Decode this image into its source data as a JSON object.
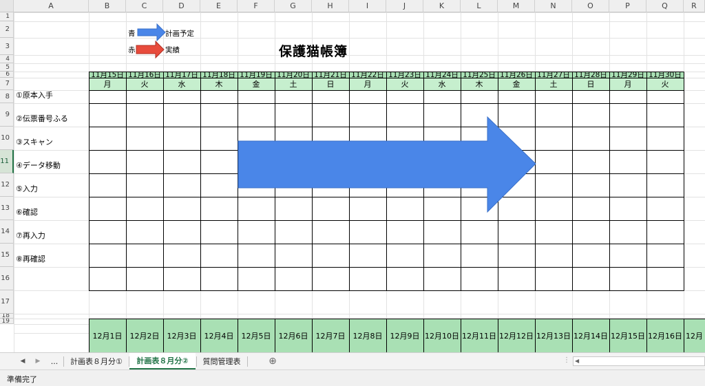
{
  "columns": [
    "A",
    "B",
    "C",
    "D",
    "E",
    "F",
    "G",
    "H",
    "I",
    "J",
    "K",
    "L",
    "M",
    "N",
    "O",
    "P",
    "Q",
    "R"
  ],
  "rows": [
    "1",
    "2",
    "3",
    "4",
    "5",
    "6",
    "7",
    "8",
    "9",
    "10",
    "11",
    "12",
    "13",
    "14",
    "15",
    "16",
    "17",
    "18",
    "19"
  ],
  "legend": {
    "blue_label": "青",
    "blue_text": "計画予定",
    "red_label": "赤",
    "red_text": "実績",
    "blue_color": "#4a86e8",
    "red_color": "#e84b3c"
  },
  "title": "保護猫帳簿",
  "dates": [
    "11月15日",
    "11月16日",
    "11月17日",
    "11月18日",
    "11月19日",
    "11月20日",
    "11月21日",
    "11月22日",
    "11月23日",
    "11月24日",
    "11月25日",
    "11月26日",
    "11月27日",
    "11月28日",
    "11月29日",
    "11月30日"
  ],
  "weekdays": [
    "月",
    "火",
    "水",
    "木",
    "金",
    "土",
    "日",
    "月",
    "火",
    "水",
    "木",
    "金",
    "土",
    "日",
    "月",
    "火"
  ],
  "tasks": [
    "①原本入手",
    "②伝票番号ふる",
    "③スキャン",
    "④データ移動",
    "⑤入力",
    "⑥確認",
    "⑦再入力",
    "⑧再確認"
  ],
  "dates2": [
    "12月1日",
    "12月2日",
    "12月3日",
    "12月4日",
    "12月5日",
    "12月6日",
    "12月7日",
    "12月8日",
    "12月9日",
    "12月10日",
    "12月11日",
    "12月12日",
    "12月13日",
    "12月14日",
    "12月15日",
    "12月16日",
    "12月"
  ],
  "tabs": {
    "ellipsis": "...",
    "items": [
      "計画表８月分①",
      "計画表８月分②",
      "質問管理表"
    ],
    "active_index": 1,
    "add": "⊕"
  },
  "status": "準備完了",
  "plan_arrow_color": "#4a86e8",
  "header_green": "#c6efce"
}
